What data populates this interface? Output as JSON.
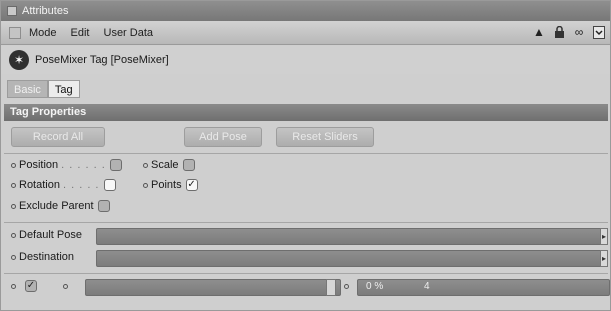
{
  "window": {
    "title": "Attributes"
  },
  "menu": {
    "items": [
      "Mode",
      "Edit",
      "User Data"
    ]
  },
  "object": {
    "title": "PoseMixer Tag [PoseMixer]"
  },
  "tabs": [
    {
      "label": "Basic",
      "active": false
    },
    {
      "label": "Tag",
      "active": true
    }
  ],
  "section": {
    "title": "Tag Properties"
  },
  "buttons": {
    "record_all": "Record All",
    "add_pose": "Add Pose",
    "reset_sliders": "Reset Sliders"
  },
  "properties": {
    "position": {
      "label": "Position",
      "leader": ". . . . . .",
      "checked": false
    },
    "scale": {
      "label": "Scale",
      "checked": false
    },
    "rotation": {
      "label": "Rotation",
      "leader": ". . . . .",
      "checked": false
    },
    "points": {
      "label": "Points",
      "checked": true
    },
    "exclude_parent": {
      "label": "Exclude Parent",
      "checked": false
    }
  },
  "links": {
    "default_pose": {
      "label": "Default Pose",
      "value": ""
    },
    "destination": {
      "label": "Destination",
      "value": ""
    }
  },
  "pose_row": {
    "enabled": true,
    "percent_text": "0 %",
    "marker": "4"
  },
  "icons": {
    "window_grip": "panel-grip-icon",
    "menu_grip": "menu-grip-icon",
    "search": "arrow-up-icon",
    "lock": "lock-icon",
    "link": "link-icon",
    "new_window": "new-window-icon",
    "tag": "posemixer-tag-icon"
  },
  "colors": {
    "title_bar": "#7f7f7f",
    "panel": "#cfcfcf",
    "section_header": "#7a7a7a",
    "field": "#848484"
  }
}
